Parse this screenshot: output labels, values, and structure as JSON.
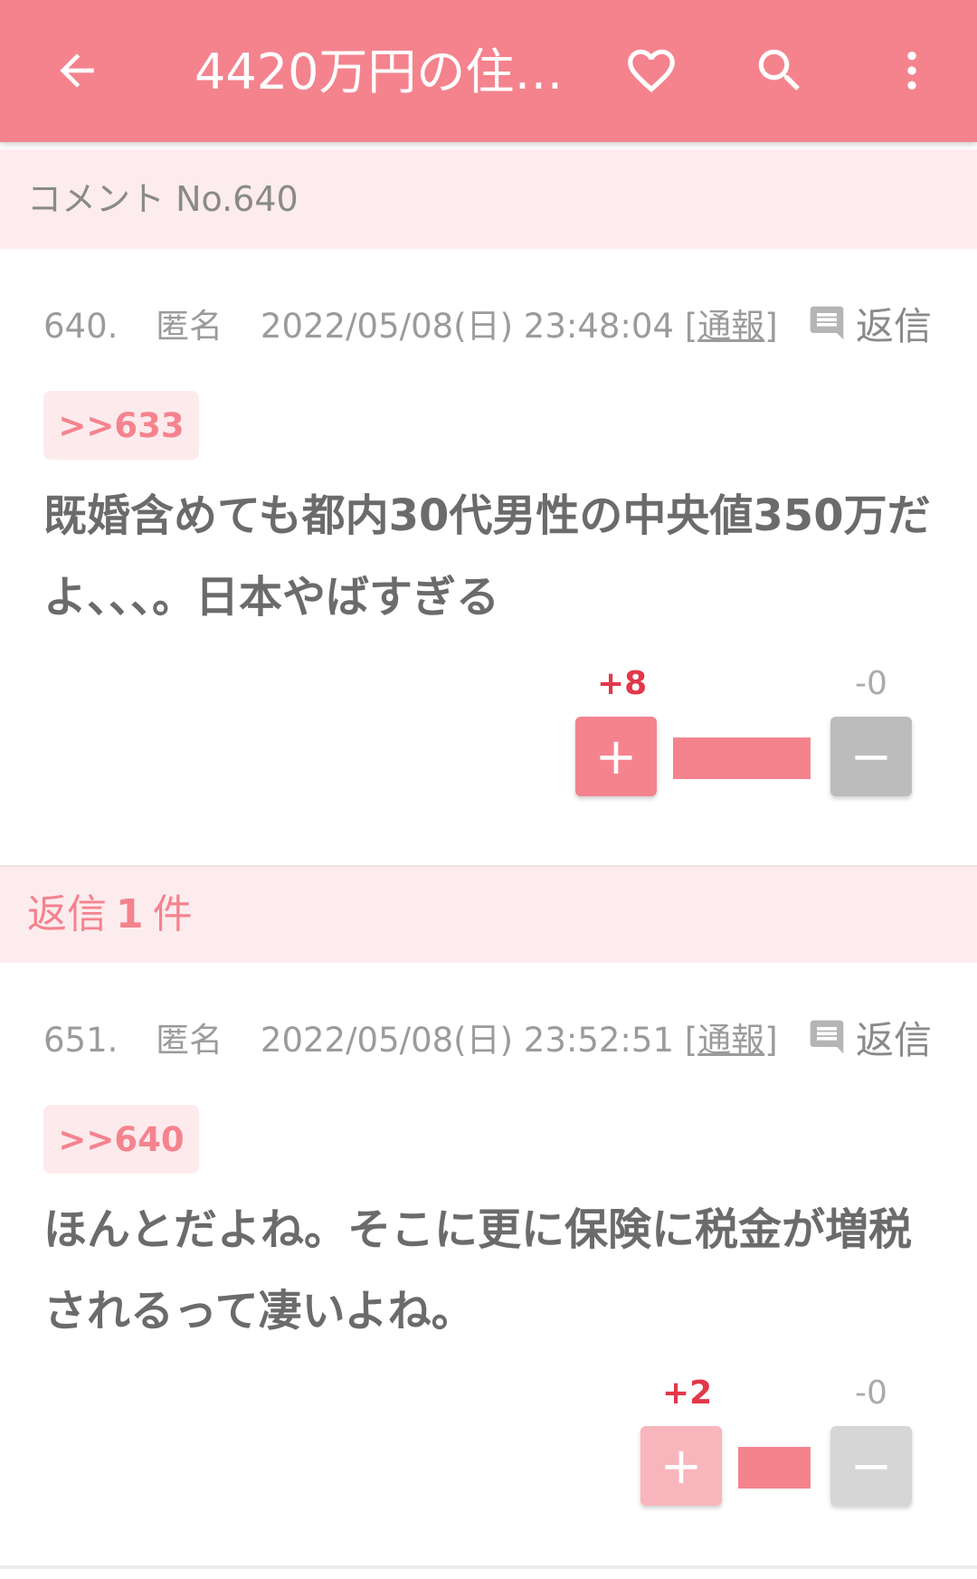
{
  "appbar": {
    "title": "4420万円の住…",
    "icons": [
      "back-arrow-icon",
      "heart-icon",
      "search-icon",
      "more-vert-icon"
    ],
    "color": "#f4838e"
  },
  "section_header": {
    "label": "コメント No.640"
  },
  "comments": [
    {
      "number": "640.",
      "author": "匿名",
      "datetime": "2022/05/08(日) 23:48:04",
      "report_open": "[",
      "report": "通報",
      "report_close": "]",
      "reply_label": "返信",
      "anchor": ">>633",
      "body": "既婚含めても都内30代男性の中央値350万だよ、、、。日本やばすぎる",
      "plus_count": "+8",
      "minus_count": "-0",
      "plus_symbol": "+",
      "minus_symbol": "−",
      "plus_ratio": 1.0
    },
    {
      "number": "651.",
      "author": "匿名",
      "datetime": "2022/05/08(日) 23:52:51",
      "report_open": "[",
      "report": "通報",
      "report_close": "]",
      "reply_label": "返信",
      "anchor": ">>640",
      "body": "ほんとだよね。そこに更に保険に税金が増税されるって凄いよね。",
      "plus_count": "+2",
      "minus_count": "-0",
      "plus_symbol": "+",
      "minus_symbol": "−",
      "plus_ratio": 1.0
    }
  ],
  "replies_header": {
    "prefix": "返信",
    "count": "1",
    "suffix": "件"
  }
}
